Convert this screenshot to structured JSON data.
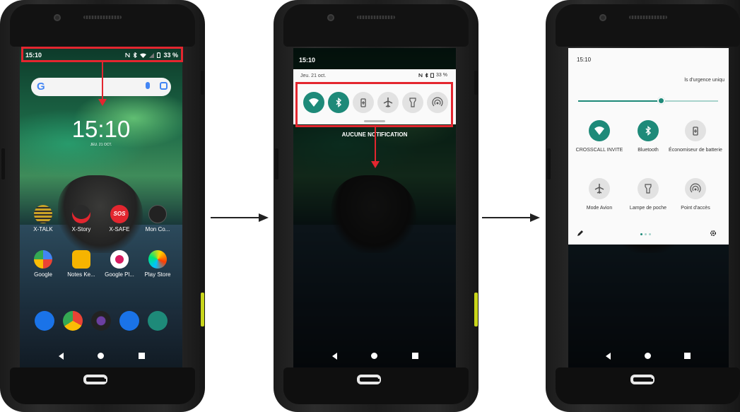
{
  "status": {
    "time": "15:10",
    "battery": "33 %"
  },
  "home": {
    "clock": "15:10",
    "date": "JEU. 21 OCT.",
    "row1": [
      {
        "label": "X-TALK",
        "color": "#c9a227"
      },
      {
        "label": "X-Story",
        "color": "#2a2a2a"
      },
      {
        "label": "X-SAFE",
        "color": "#e3262f"
      },
      {
        "label": "Mon Co...",
        "color": "#222222"
      }
    ],
    "row2": [
      {
        "label": "Google",
        "color": "#ffffff"
      },
      {
        "label": "Notes Ke...",
        "color": "#f6b400"
      },
      {
        "label": "Google Pl...",
        "color": "#ffffff"
      },
      {
        "label": "Play Store",
        "color": "#ffffff"
      }
    ]
  },
  "notifications": {
    "date": "Jeu. 21 oct.",
    "battery": "33 %",
    "empty": "AUCUNE NOTIFICATION"
  },
  "quick_settings": {
    "header": "ls d'urgence uniqu",
    "tiles": [
      {
        "label": "CROSSCALL INVITE",
        "icon": "wifi-icon",
        "state": "on"
      },
      {
        "label": "Bluetooth",
        "icon": "bluetooth-icon",
        "state": "on"
      },
      {
        "label": "Économiseur de batterie",
        "icon": "battery-saver-icon",
        "state": "off"
      },
      {
        "label": "Mode Avion",
        "icon": "airplane-icon",
        "state": "off"
      },
      {
        "label": "Lampe de poche",
        "icon": "flashlight-icon",
        "state": "off"
      },
      {
        "label": "Point d'accès",
        "icon": "hotspot-icon",
        "state": "off"
      }
    ],
    "brightness": 0.6
  },
  "colors": {
    "accent": "#1e8a79",
    "highlight": "#e3262f",
    "rugged_key": "#c9d61c"
  }
}
